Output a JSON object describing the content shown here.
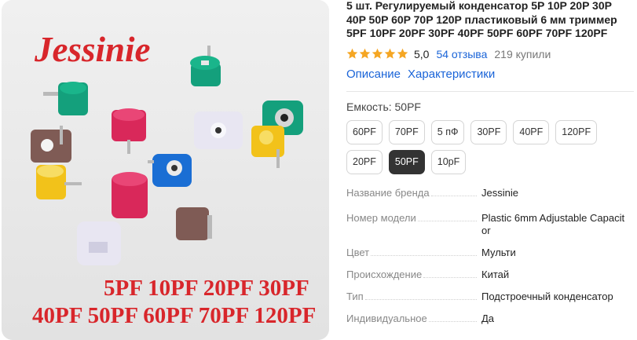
{
  "image": {
    "brand_logo_text": "Jessinie",
    "caption_line1": "5PF 10PF 20PF 30PF",
    "caption_line2": "40PF 50PF 60PF 70PF 120PF"
  },
  "product": {
    "title": "5 шт. Регулируемый конденсатор 5P 10P 20P 30P 40P 50P 60P 70P 120P пластиковый 6 мм триммер 5PF 10PF 20PF 30PF 40PF 50PF 60PF 70PF 120PF",
    "rating": "5,0",
    "stars": 5,
    "reviews": "54 отзыва",
    "sold": "219 купили"
  },
  "tabs": [
    "Описание",
    "Характеристики"
  ],
  "capacity": {
    "label": "Емкость: 50PF",
    "options": [
      "60PF",
      "70PF",
      "5 пФ",
      "30PF",
      "40PF",
      "120PF",
      "20PF",
      "50PF",
      "10pF"
    ],
    "selected_index": 7
  },
  "specs": [
    {
      "key": "Название бренда",
      "value": "Jessinie"
    },
    {
      "key": "Номер модели",
      "value": "Plastic 6mm Adjustable Capacitor"
    },
    {
      "key": "Цвет",
      "value": "Мульти"
    },
    {
      "key": "Происхождение",
      "value": "Китай"
    },
    {
      "key": "Тип",
      "value": "Подстроечный конденсатор"
    },
    {
      "key": "Индивидуальное",
      "value": "Да"
    }
  ],
  "colors": {
    "star": "#f5a623",
    "link": "#1a64d8",
    "logo_red": "#d8262b",
    "selected_bg": "#333333"
  }
}
